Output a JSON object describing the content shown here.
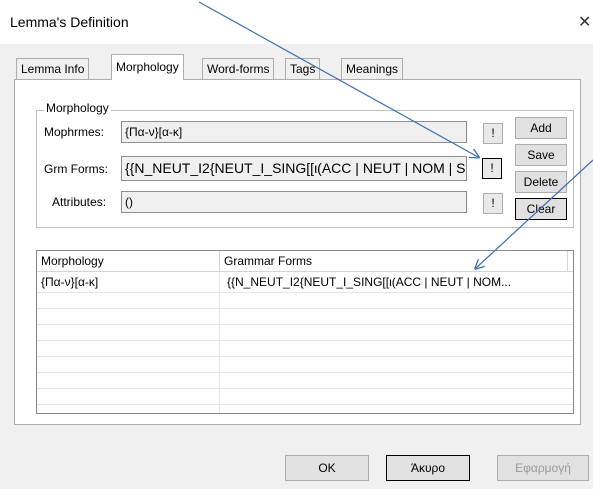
{
  "window": {
    "title": "Lemma's Definition",
    "close_glyph": "✕"
  },
  "tabs": [
    {
      "label": "Lemma Info"
    },
    {
      "label": "Morphology",
      "active": true
    },
    {
      "label": "Word-forms"
    },
    {
      "label": "Tags"
    },
    {
      "label": "Meanings"
    }
  ],
  "morph_group": {
    "label": "Morphology",
    "morphemes_label": "Mophrmes:",
    "morphemes_value": "{Πα-ν}[α-κ]",
    "grm_label": "Grm Forms:",
    "grm_value": "{{N_NEUT_I2{NEUT_I_SING[[ι(ACC | NEUT | NOM | S",
    "attributes_label": "Attributes:",
    "attributes_value": "()",
    "bang_label": "!"
  },
  "side_buttons": {
    "add": "Add",
    "save": "Save",
    "delete": "Delete",
    "clear": "Clear"
  },
  "list": {
    "columns": [
      "Morphology",
      "Grammar Forms"
    ],
    "rows": [
      {
        "morphology": "{Πα-ν}[α-κ]",
        "grammar_forms": "{{N_NEUT_I2{NEUT_I_SING[[ι(ACC | NEUT | NOM..."
      }
    ]
  },
  "footer": {
    "ok": "OK",
    "cancel": "Άκυρο",
    "apply": "Εφαρμογή"
  },
  "colors": {
    "annotation_arrow": "#3e6fb5",
    "dialog_bg": "#f0f0f0",
    "panel_bg": "#ffffff"
  }
}
